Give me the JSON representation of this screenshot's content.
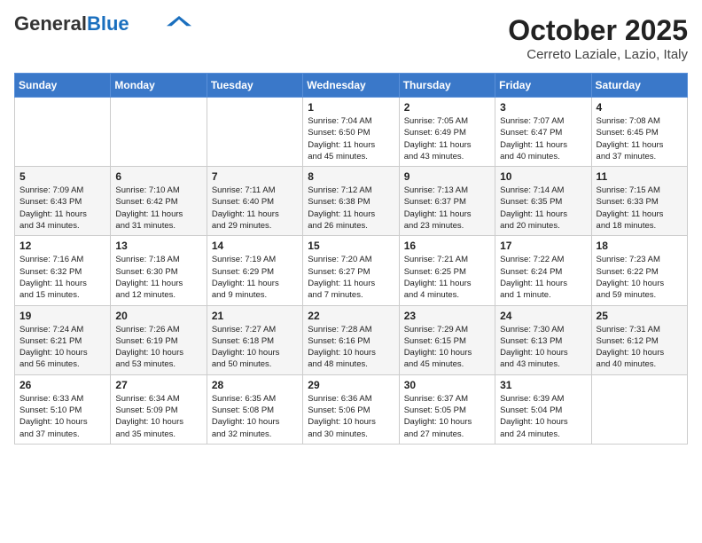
{
  "header": {
    "logo_general": "General",
    "logo_blue": "Blue",
    "title": "October 2025",
    "subtitle": "Cerreto Laziale, Lazio, Italy"
  },
  "weekdays": [
    "Sunday",
    "Monday",
    "Tuesday",
    "Wednesday",
    "Thursday",
    "Friday",
    "Saturday"
  ],
  "weeks": [
    [
      {
        "day": "",
        "text": ""
      },
      {
        "day": "",
        "text": ""
      },
      {
        "day": "",
        "text": ""
      },
      {
        "day": "1",
        "text": "Sunrise: 7:04 AM\nSunset: 6:50 PM\nDaylight: 11 hours\nand 45 minutes."
      },
      {
        "day": "2",
        "text": "Sunrise: 7:05 AM\nSunset: 6:49 PM\nDaylight: 11 hours\nand 43 minutes."
      },
      {
        "day": "3",
        "text": "Sunrise: 7:07 AM\nSunset: 6:47 PM\nDaylight: 11 hours\nand 40 minutes."
      },
      {
        "day": "4",
        "text": "Sunrise: 7:08 AM\nSunset: 6:45 PM\nDaylight: 11 hours\nand 37 minutes."
      }
    ],
    [
      {
        "day": "5",
        "text": "Sunrise: 7:09 AM\nSunset: 6:43 PM\nDaylight: 11 hours\nand 34 minutes."
      },
      {
        "day": "6",
        "text": "Sunrise: 7:10 AM\nSunset: 6:42 PM\nDaylight: 11 hours\nand 31 minutes."
      },
      {
        "day": "7",
        "text": "Sunrise: 7:11 AM\nSunset: 6:40 PM\nDaylight: 11 hours\nand 29 minutes."
      },
      {
        "day": "8",
        "text": "Sunrise: 7:12 AM\nSunset: 6:38 PM\nDaylight: 11 hours\nand 26 minutes."
      },
      {
        "day": "9",
        "text": "Sunrise: 7:13 AM\nSunset: 6:37 PM\nDaylight: 11 hours\nand 23 minutes."
      },
      {
        "day": "10",
        "text": "Sunrise: 7:14 AM\nSunset: 6:35 PM\nDaylight: 11 hours\nand 20 minutes."
      },
      {
        "day": "11",
        "text": "Sunrise: 7:15 AM\nSunset: 6:33 PM\nDaylight: 11 hours\nand 18 minutes."
      }
    ],
    [
      {
        "day": "12",
        "text": "Sunrise: 7:16 AM\nSunset: 6:32 PM\nDaylight: 11 hours\nand 15 minutes."
      },
      {
        "day": "13",
        "text": "Sunrise: 7:18 AM\nSunset: 6:30 PM\nDaylight: 11 hours\nand 12 minutes."
      },
      {
        "day": "14",
        "text": "Sunrise: 7:19 AM\nSunset: 6:29 PM\nDaylight: 11 hours\nand 9 minutes."
      },
      {
        "day": "15",
        "text": "Sunrise: 7:20 AM\nSunset: 6:27 PM\nDaylight: 11 hours\nand 7 minutes."
      },
      {
        "day": "16",
        "text": "Sunrise: 7:21 AM\nSunset: 6:25 PM\nDaylight: 11 hours\nand 4 minutes."
      },
      {
        "day": "17",
        "text": "Sunrise: 7:22 AM\nSunset: 6:24 PM\nDaylight: 11 hours\nand 1 minute."
      },
      {
        "day": "18",
        "text": "Sunrise: 7:23 AM\nSunset: 6:22 PM\nDaylight: 10 hours\nand 59 minutes."
      }
    ],
    [
      {
        "day": "19",
        "text": "Sunrise: 7:24 AM\nSunset: 6:21 PM\nDaylight: 10 hours\nand 56 minutes."
      },
      {
        "day": "20",
        "text": "Sunrise: 7:26 AM\nSunset: 6:19 PM\nDaylight: 10 hours\nand 53 minutes."
      },
      {
        "day": "21",
        "text": "Sunrise: 7:27 AM\nSunset: 6:18 PM\nDaylight: 10 hours\nand 50 minutes."
      },
      {
        "day": "22",
        "text": "Sunrise: 7:28 AM\nSunset: 6:16 PM\nDaylight: 10 hours\nand 48 minutes."
      },
      {
        "day": "23",
        "text": "Sunrise: 7:29 AM\nSunset: 6:15 PM\nDaylight: 10 hours\nand 45 minutes."
      },
      {
        "day": "24",
        "text": "Sunrise: 7:30 AM\nSunset: 6:13 PM\nDaylight: 10 hours\nand 43 minutes."
      },
      {
        "day": "25",
        "text": "Sunrise: 7:31 AM\nSunset: 6:12 PM\nDaylight: 10 hours\nand 40 minutes."
      }
    ],
    [
      {
        "day": "26",
        "text": "Sunrise: 6:33 AM\nSunset: 5:10 PM\nDaylight: 10 hours\nand 37 minutes."
      },
      {
        "day": "27",
        "text": "Sunrise: 6:34 AM\nSunset: 5:09 PM\nDaylight: 10 hours\nand 35 minutes."
      },
      {
        "day": "28",
        "text": "Sunrise: 6:35 AM\nSunset: 5:08 PM\nDaylight: 10 hours\nand 32 minutes."
      },
      {
        "day": "29",
        "text": "Sunrise: 6:36 AM\nSunset: 5:06 PM\nDaylight: 10 hours\nand 30 minutes."
      },
      {
        "day": "30",
        "text": "Sunrise: 6:37 AM\nSunset: 5:05 PM\nDaylight: 10 hours\nand 27 minutes."
      },
      {
        "day": "31",
        "text": "Sunrise: 6:39 AM\nSunset: 5:04 PM\nDaylight: 10 hours\nand 24 minutes."
      },
      {
        "day": "",
        "text": ""
      }
    ]
  ]
}
